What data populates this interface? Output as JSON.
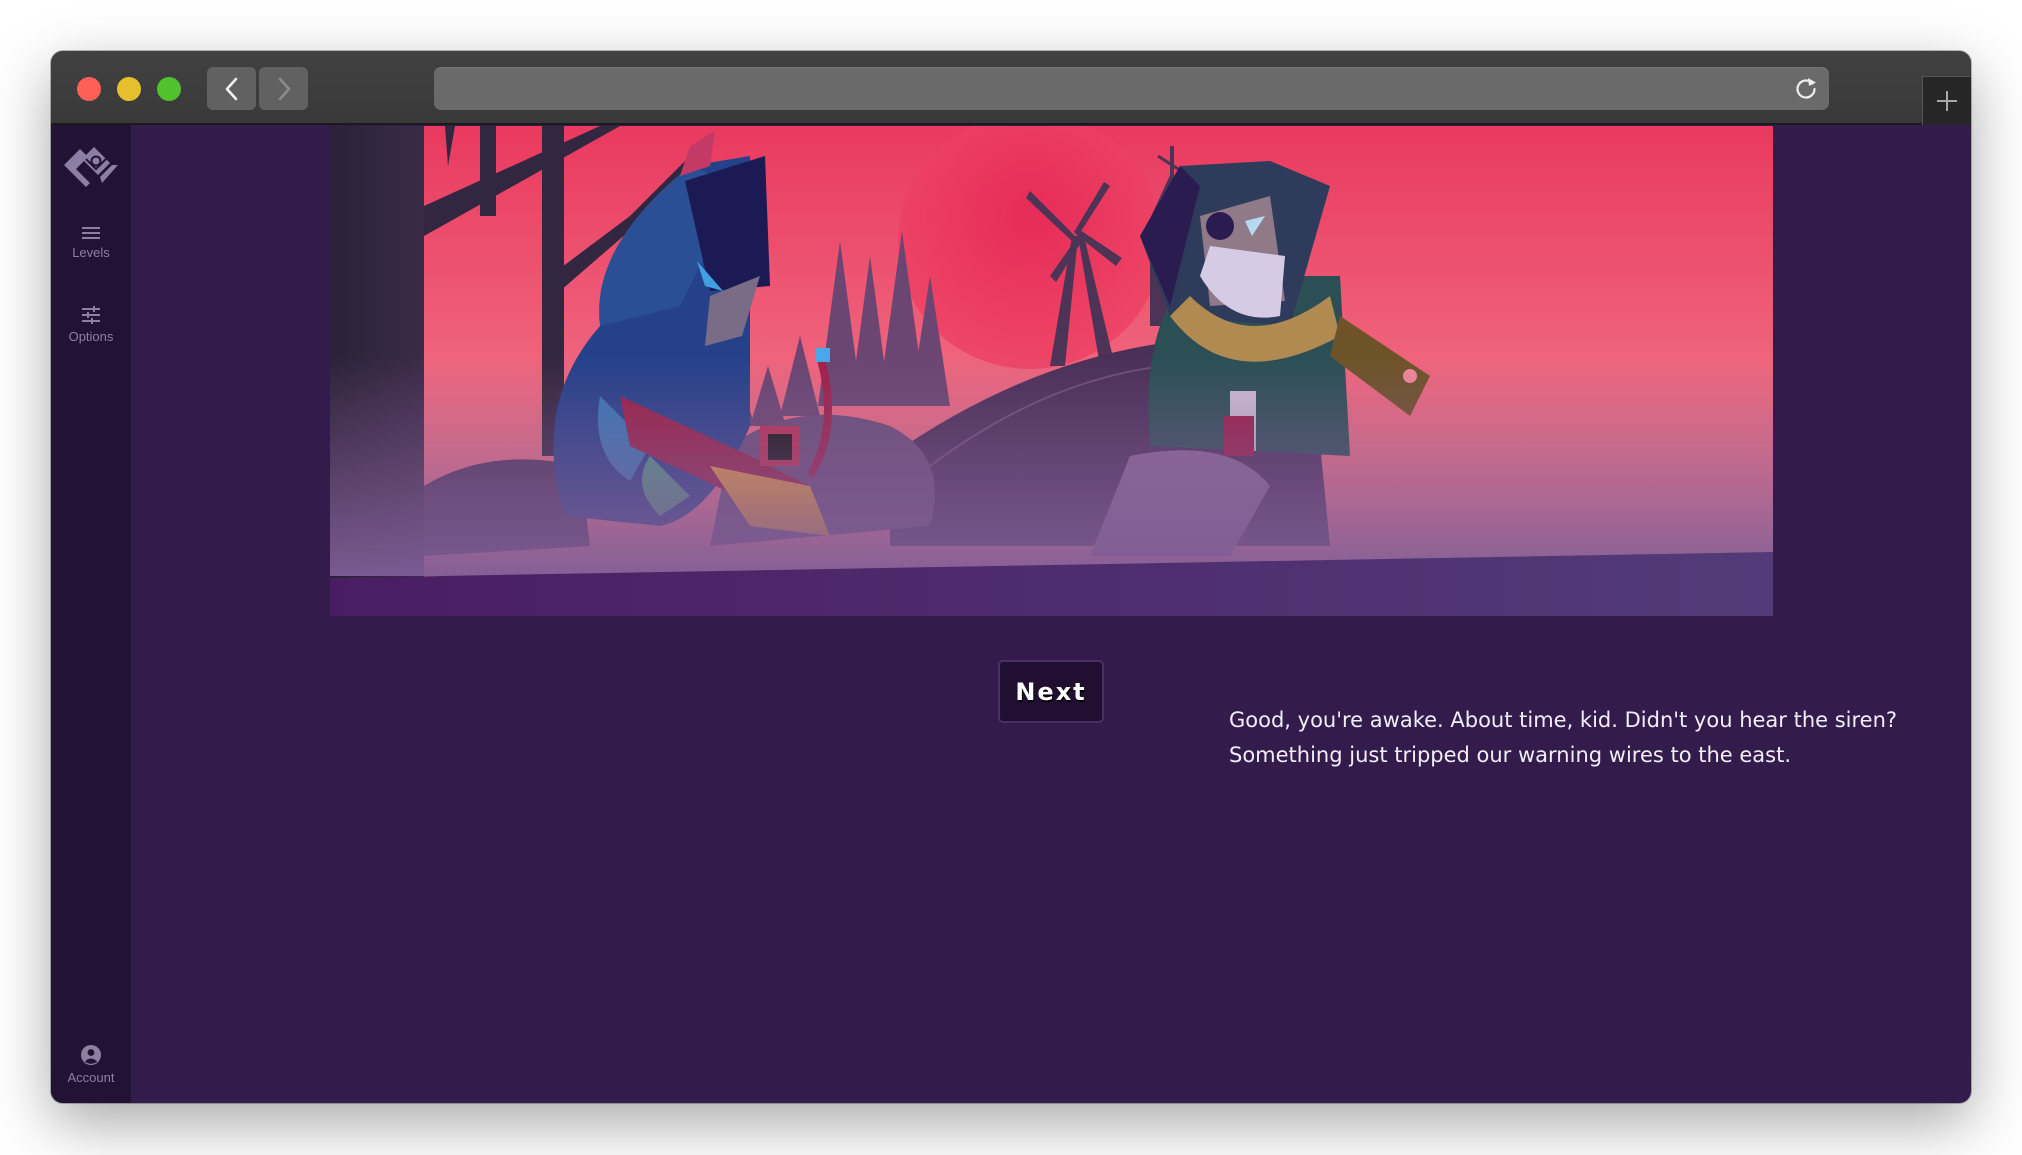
{
  "browser": {
    "url": "",
    "traffic_lights": [
      "close",
      "minimize",
      "maximize"
    ],
    "back_icon": "chevron-left-icon",
    "forward_icon": "chevron-right-icon",
    "reload_icon": "reload-icon",
    "new_tab_icon": "plus-icon"
  },
  "sidebar": {
    "logo": "game-logo",
    "items": [
      {
        "label": "Levels",
        "icon": "menu-icon"
      },
      {
        "label": "Options",
        "icon": "sliders-icon"
      }
    ],
    "account": {
      "label": "Account",
      "icon": "user-circle-icon"
    }
  },
  "scene": {
    "illustration": "Two hooded characters in a dusky pink forest: a young blue-hooded hero holding a red crossbow, and an old bearded man with an eyepatch, scarf and green cloak; a red sun with a windmill and tower behind a hill.",
    "colors": {
      "sky_top": "#e9395f",
      "sky_bottom": "#f4879a",
      "sun": "#e8315a",
      "ground": "#4a1f64",
      "page_bg": "#331c4c",
      "sidebar_bg": "#221234"
    }
  },
  "controls": {
    "next_label": "Next"
  },
  "dialog": {
    "lines": [
      "Good, you're awake. About time, kid. Didn't you hear the siren?",
      "Something just tripped our warning wires to the east."
    ]
  }
}
